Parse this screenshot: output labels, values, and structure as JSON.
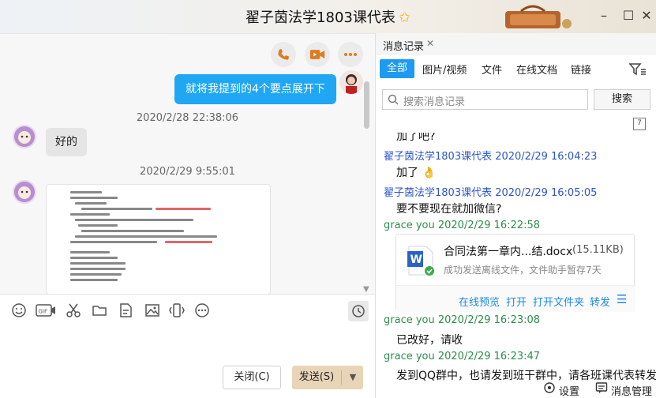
{
  "window": {
    "title": "翟子茵法学1803课代表",
    "min": "–",
    "max": "☐",
    "close": "✕"
  },
  "chat": {
    "outgoing_message": "就将我提到的4个要点展开下",
    "timestamp1": "2020/2/28 22:38:06",
    "incoming_reply": "好的",
    "timestamp2": "2020/2/29 9:55:01"
  },
  "compose": {
    "close_label": "关闭(C)",
    "send_label": "发送(S)"
  },
  "history": {
    "tab_title": "消息记录",
    "categories": [
      "全部",
      "图片/视频",
      "文件",
      "在线文档",
      "链接"
    ],
    "search_placeholder": "搜索消息记录",
    "search_button": "搜索",
    "calendar_day": "7",
    "messages": [
      {
        "text": "加了吧?"
      },
      {
        "sender": "翟子茵法学1803课代表 2020/2/29 16:04:23",
        "text": "加了"
      },
      {
        "sender": "翟子茵法学1803课代表 2020/2/29 16:05:05",
        "text": "要不要现在就加微信?"
      },
      {
        "sender": "grace you 2020/2/29 16:22:58"
      },
      {
        "sender": "grace you 2020/2/29 16:23:08",
        "text": "已改好，请收"
      },
      {
        "sender": "grace you 2020/2/29 16:23:47",
        "text": "发到QQ群中，也请发到班干群中，请各班课代表转发"
      }
    ],
    "file": {
      "name": "合同法第一章内...结.docx",
      "size": "(15.11KB)",
      "status": "成功发送离线文件，文件助手暂存7天",
      "actions": [
        "在线预览",
        "打开",
        "打开文件夹",
        "转发"
      ]
    },
    "footer": {
      "settings": "设置",
      "manage": "消息管理"
    }
  },
  "colors": {
    "accent": "#1e9af2",
    "sender_blue": "#2b55c9",
    "sender_green": "#2d8c4a",
    "send_button": "#e8d4b6"
  }
}
